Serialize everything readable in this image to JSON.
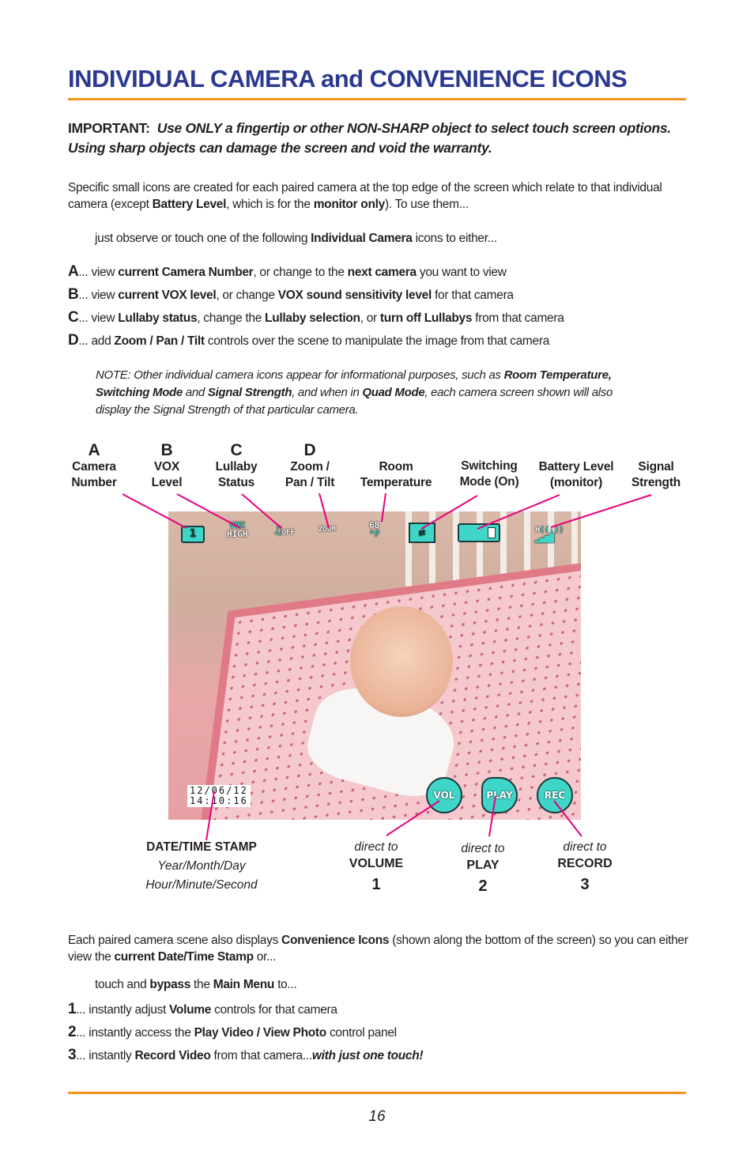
{
  "title": "INDIVIDUAL CAMERA and CONVENIENCE ICONS",
  "important": {
    "label": "IMPORTANT:",
    "text": "Use ONLY a fingertip or other NON-SHARP object to select touch screen options. Using sharp objects can damage the screen and void the warranty."
  },
  "intro": {
    "p1_a": "Specific small icons are created for each paired camera at the top edge of the screen which relate to that individual camera (except ",
    "p1_b": "Battery Level",
    "p1_c": ", which is for the ",
    "p1_d": "monitor only",
    "p1_e": "). To use them...",
    "p2_a": "just observe or touch one of the following ",
    "p2_b": "Individual Camera",
    "p2_c": " icons to either..."
  },
  "camera_items": [
    {
      "letter": "A",
      "t1": "... view ",
      "b1": "current Camera Number",
      "t2": ", or change to the ",
      "b2": "next camera",
      "t3": " you want to view",
      "b3": "",
      "t4": ""
    },
    {
      "letter": "B",
      "t1": "... view ",
      "b1": "current VOX level",
      "t2": ", or change ",
      "b2": "VOX sound sensitivity level",
      "t3": " for that camera",
      "b3": "",
      "t4": ""
    },
    {
      "letter": "C",
      "t1": "... view ",
      "b1": "Lullaby status",
      "t2": ", change the ",
      "b2": "Lullaby selection",
      "t3": ", or ",
      "b3": "turn off Lullabys",
      "t4": " from that camera"
    },
    {
      "letter": "D",
      "t1": "... add ",
      "b1": "Zoom / Pan / Tilt",
      "t2": " controls over the scene to manipulate the image from that camera",
      "b2": "",
      "t3": "",
      "b3": "",
      "t4": ""
    }
  ],
  "note": {
    "a": "NOTE: Other individual camera icons appear for informational purposes, such as ",
    "b": "Room Temperature, Switching Mode",
    "c": " and ",
    "d": "Signal Strength",
    "e": ", and when in ",
    "f": "Quad Mode",
    "g": ", each camera screen shown will also display the Signal Strength of that particular camera."
  },
  "top_labels": [
    {
      "letter": "A",
      "line1": "Camera",
      "line2": "Number"
    },
    {
      "letter": "B",
      "line1": "VOX",
      "line2": "Level"
    },
    {
      "letter": "C",
      "line1": "Lullaby",
      "line2": "Status"
    },
    {
      "letter": "D",
      "line1": "Zoom /",
      "line2": "Pan / Tilt"
    },
    {
      "letter": "",
      "line1": "Room",
      "line2": "Temperature"
    },
    {
      "letter": "",
      "line1": "Switching",
      "line2": "Mode (On)"
    },
    {
      "letter": "",
      "line1": "Battery Level",
      "line2": "(monitor)"
    },
    {
      "letter": "",
      "line1": "Signal",
      "line2": "Strength"
    }
  ],
  "osd": {
    "camera_number": "1",
    "vox_top": "VOX",
    "vox_bottom": "HIGH",
    "lullaby": "OFF",
    "zoom": "ZOOM",
    "temp_value": "68",
    "temp_unit": "°F",
    "signal_band": "H",
    "date": "12/06/12",
    "time": "14:10:16",
    "vol": "VOL",
    "play": "PLAY",
    "rec": "REC",
    "accent_color": "#3fd6c9"
  },
  "bottom_labels": {
    "datestamp_title": "DATE/TIME STAMP",
    "datestamp_line1": "Year/Month/Day",
    "datestamp_line2": "Hour/Minute/Second",
    "items": [
      {
        "small": "direct to",
        "big": "VOLUME",
        "num": "1"
      },
      {
        "small": "direct to",
        "big": "PLAY",
        "num": "2"
      },
      {
        "small": "direct to",
        "big": "RECORD",
        "num": "3"
      }
    ]
  },
  "convenience": {
    "p1_a": "Each paired camera scene also displays ",
    "p1_b": "Convenience Icons",
    "p1_c": " (shown along the bottom of the screen) so you can either view the ",
    "p1_d": "current Date/Time Stamp",
    "p1_e": " or...",
    "p2_a": "touch and ",
    "p2_b": "bypass",
    "p2_c": " the ",
    "p2_d": "Main Menu",
    "p2_e": " to..."
  },
  "convenience_items": [
    {
      "num": "1",
      "t1": "... instantly adjust ",
      "b1": "Volume",
      "t2": " controls for that camera",
      "bi": ""
    },
    {
      "num": "2",
      "t1": "... instantly access the ",
      "b1": "Play Video / View Photo",
      "t2": " control panel",
      "bi": ""
    },
    {
      "num": "3",
      "t1": "... instantly ",
      "b1": "Record Video",
      "t2": " from that camera...",
      "bi": "with just one touch!"
    }
  ],
  "page_number": "16",
  "colors": {
    "title": "#2b3990",
    "rule": "#f7941d",
    "leader": "#e6007e"
  }
}
